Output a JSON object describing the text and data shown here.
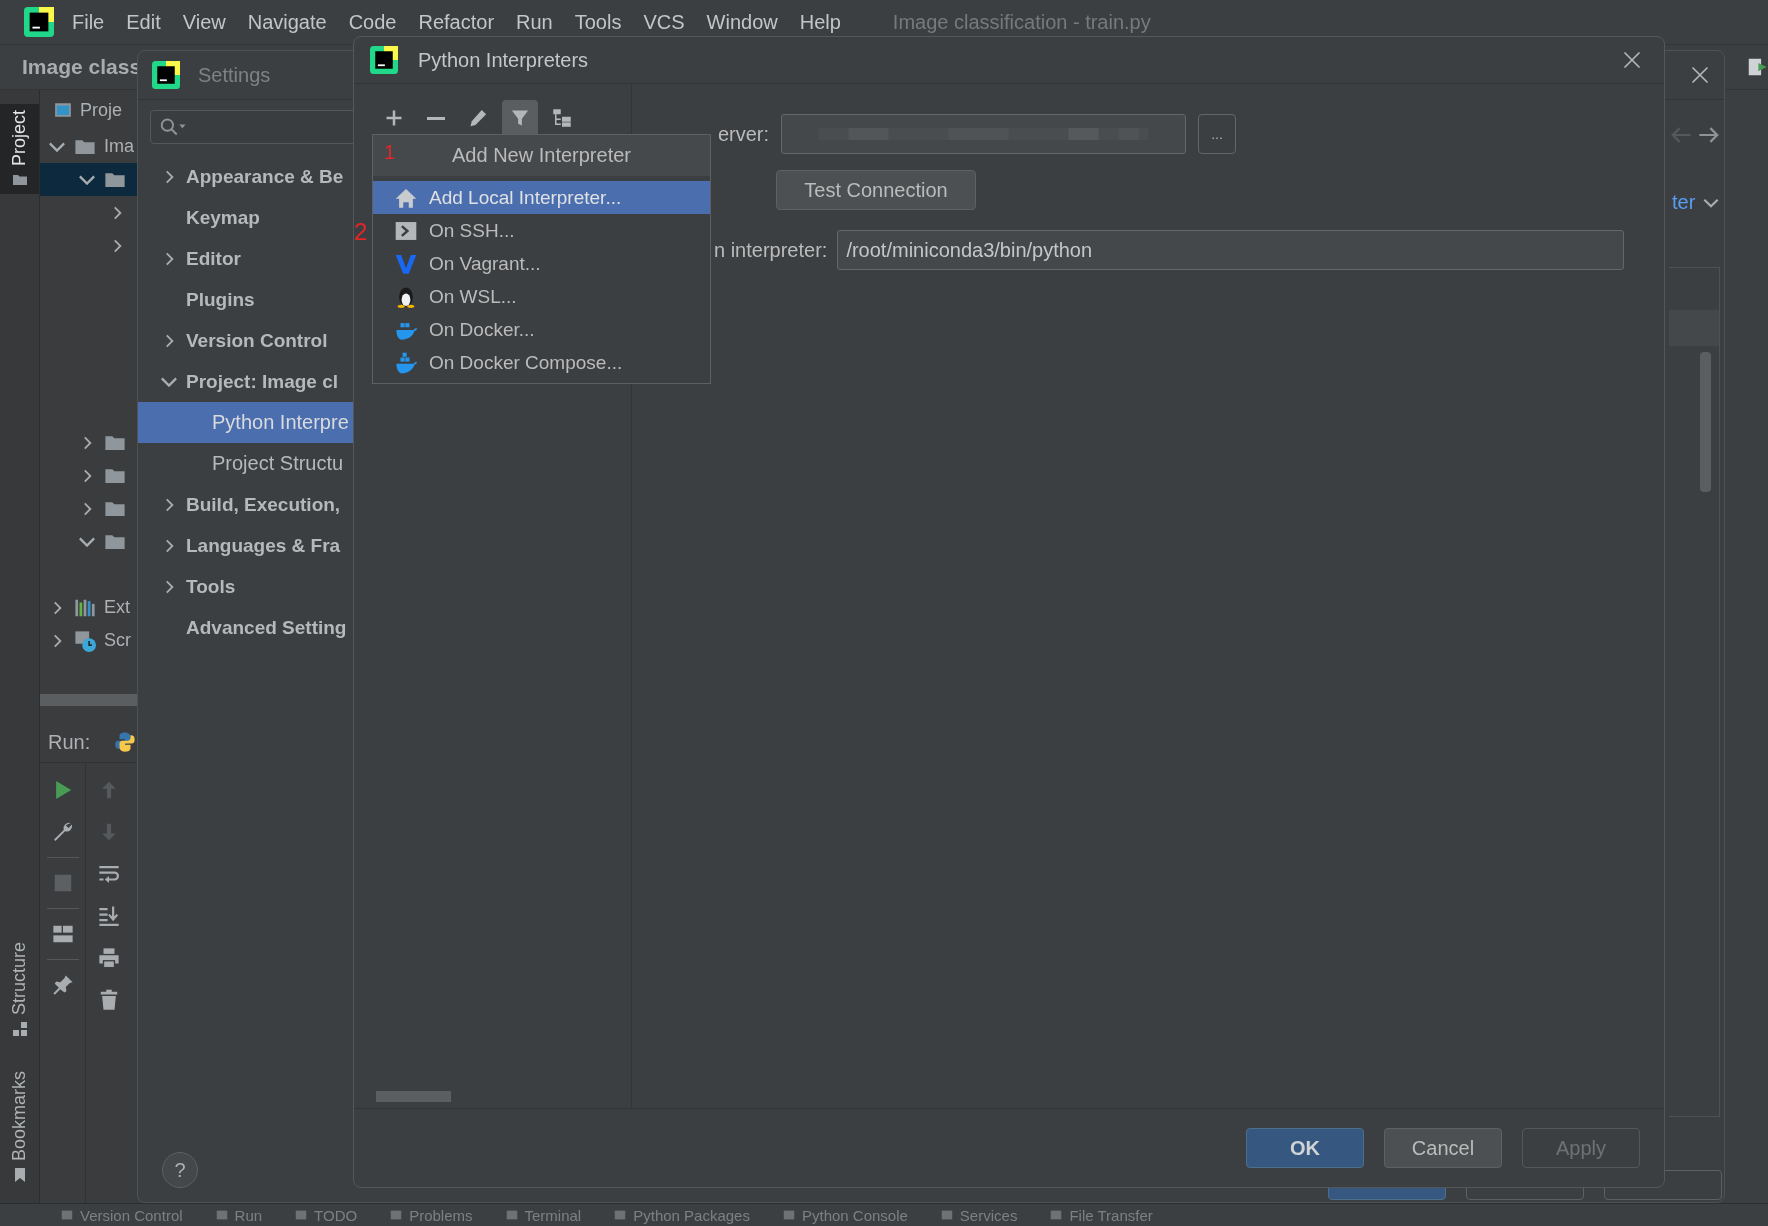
{
  "menu_bar": {
    "items": [
      "File",
      "Edit",
      "View",
      "Navigate",
      "Code",
      "Refactor",
      "Run",
      "Tools",
      "VCS",
      "Window",
      "Help"
    ],
    "title": "Image classification - train.py"
  },
  "project_window": {
    "nav_title": "Image class",
    "stripes_top": [
      {
        "label": "Project",
        "selected": true
      }
    ],
    "stripes_bottom": [
      {
        "label": "Structure",
        "selected": false
      },
      {
        "label": "Bookmarks",
        "selected": false
      }
    ],
    "header": "Proje",
    "tree": [
      {
        "label": "Ima",
        "kind": "folder",
        "expanded": true,
        "selected": false,
        "children": [
          {
            "kind": "folder",
            "expanded": true,
            "selected": true,
            "children": [
              {
                "expanded": false,
                "selected": false
              },
              {
                "expanded": false,
                "selected": false
              }
            ]
          },
          {
            "kind": "folder",
            "expanded": false,
            "selected": false
          },
          {
            "kind": "folder",
            "expanded": false,
            "selected": false
          },
          {
            "kind": "folder",
            "expanded": false,
            "selected": false
          },
          {
            "kind": "folder",
            "expanded": true,
            "selected": false
          }
        ]
      },
      {
        "label": "Ext",
        "kind": "library",
        "expanded": false,
        "selected": false
      },
      {
        "label": "Scr",
        "kind": "scratch",
        "expanded": false,
        "selected": false
      }
    ],
    "run_label": "Run:"
  },
  "status_bar": {
    "items": [
      "Version Control",
      "Run",
      "TODO",
      "Problems",
      "Terminal",
      "Python Packages",
      "Python Console",
      "Services",
      "File Transfer"
    ]
  },
  "settings": {
    "title": "Settings",
    "tree": [
      {
        "label": "Appearance & Be",
        "expanded": false,
        "selected": false
      },
      {
        "label": "Keymap",
        "selected": false
      },
      {
        "label": "Editor",
        "expanded": false,
        "selected": false
      },
      {
        "label": "Plugins",
        "selected": false
      },
      {
        "label": "Version Control",
        "expanded": false,
        "selected": false
      },
      {
        "label": "Project: Image cl",
        "expanded": true,
        "selected": false,
        "children": [
          {
            "label": "Python Interpre",
            "selected": true
          },
          {
            "label": "Project Structu",
            "selected": false
          }
        ]
      },
      {
        "label": "Build, Execution,",
        "expanded": false,
        "selected": false
      },
      {
        "label": "Languages & Fra",
        "expanded": false,
        "selected": false
      },
      {
        "label": "Tools",
        "expanded": false,
        "selected": false
      },
      {
        "label": "Advanced Setting",
        "selected": false
      }
    ],
    "help": "?",
    "link": "ter"
  },
  "interpreters_dialog": {
    "title": "Python Interpreters",
    "toolbar": [
      {
        "kind": "add",
        "selected": false
      },
      {
        "kind": "remove",
        "selected": false
      },
      {
        "kind": "edit",
        "selected": false
      },
      {
        "kind": "filter",
        "selected": true
      },
      {
        "kind": "tree",
        "selected": false
      }
    ],
    "ssh_label": "erver:",
    "browse": "...",
    "test_button": "Test Connection",
    "interpreter_label": "n interpreter:",
    "interpreter_path": "/root/miniconda3/bin/python",
    "buttons": [
      {
        "label": "OK",
        "kind": "primary",
        "disabled": false
      },
      {
        "label": "Cancel",
        "kind": "normal",
        "disabled": false
      },
      {
        "label": "Apply",
        "kind": "normal",
        "disabled": true
      }
    ]
  },
  "popup_menu": {
    "title": "Add New Interpreter",
    "items": [
      {
        "label": "Add Local Interpreter...",
        "kind": "local",
        "selected": true
      },
      {
        "label": "On SSH...",
        "kind": "ssh",
        "selected": false
      },
      {
        "label": "On Vagrant...",
        "kind": "vagrant",
        "selected": false
      },
      {
        "label": "On WSL...",
        "kind": "wsl",
        "selected": false
      },
      {
        "label": "On Docker...",
        "kind": "docker",
        "selected": false
      },
      {
        "label": "On Docker Compose...",
        "kind": "compose",
        "selected": false
      }
    ]
  },
  "annotations": [
    {
      "text": "1"
    },
    {
      "text": "2"
    }
  ]
}
